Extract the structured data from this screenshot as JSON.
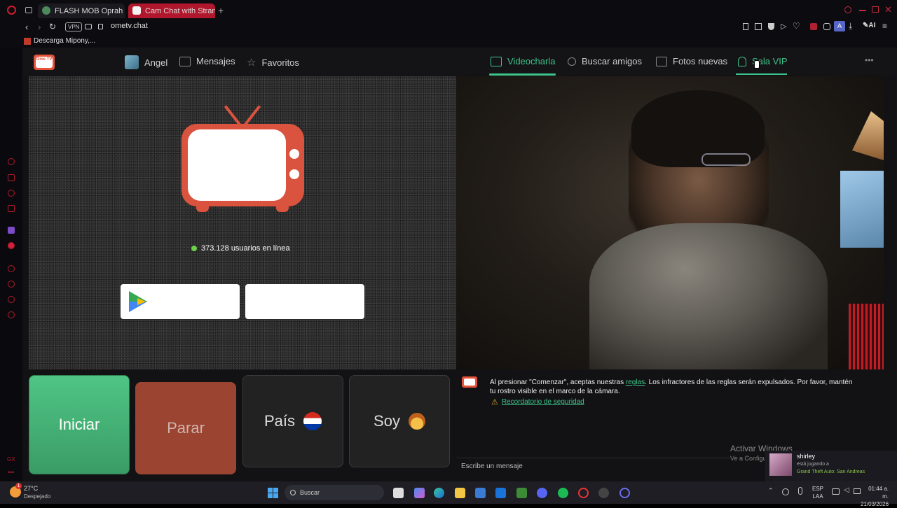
{
  "browser": {
    "tabs": [
      {
        "label": "FLASH MOB Oprah vs. Bla",
        "active": false
      },
      {
        "label": "Cam Chat with Strange",
        "active": true
      }
    ],
    "vpn": "VPN",
    "url": "ometv.chat",
    "ai": "AI",
    "bookmark": "Descarga Mipony,..."
  },
  "site": {
    "logo": "Ome TV",
    "nav_left": [
      {
        "label": "Angel",
        "icon": "user-avatar-icon"
      },
      {
        "label": "Mensajes",
        "icon": "mail-icon"
      },
      {
        "label": "Favoritos",
        "icon": "star-icon"
      }
    ],
    "nav_right": [
      {
        "label": "Videocharla",
        "icon": "video-chat-icon",
        "active": true
      },
      {
        "label": "Buscar amigos",
        "icon": "search-icon"
      },
      {
        "label": "Fotos nuevas",
        "icon": "photos-icon"
      },
      {
        "label": "Sala VIP",
        "icon": "vip-icon"
      }
    ],
    "more": "•••",
    "online": "373.128 usuarios en línea",
    "buttons": {
      "start": "Iniciar",
      "stop": "Parar",
      "country": "País",
      "gender": "Soy"
    },
    "notice": {
      "part1": "Al presionar \"Comenzar\", aceptas nuestras ",
      "link": "reglas",
      "part2": ". Los infractores de las reglas serán expulsados. Por favor, mantén tu rostro visible en el marco de la cámara.",
      "reminder": "Recordatorio de seguridad"
    },
    "activate_title": "Activar Windows",
    "activate_sub": "Ve a Configuración para activar Windows.",
    "message_placeholder": "Escribe un mensaje",
    "toast": {
      "name": "shirley",
      "status": "está jugando a",
      "game": "Grand Theft Auto: San Andreas"
    }
  },
  "taskbar": {
    "temp": "27°C",
    "weather": "Despejado",
    "search": "Buscar",
    "lang1": "ESP",
    "lang2": "LAA",
    "time": "01:44 a. m.",
    "date": "21/03/2026",
    "badge": "1"
  },
  "colors": {
    "accent_green": "#3ec38a",
    "tv_red": "#d9533e",
    "stop_red": "#9b4432",
    "start_green": "#3fa86e"
  }
}
